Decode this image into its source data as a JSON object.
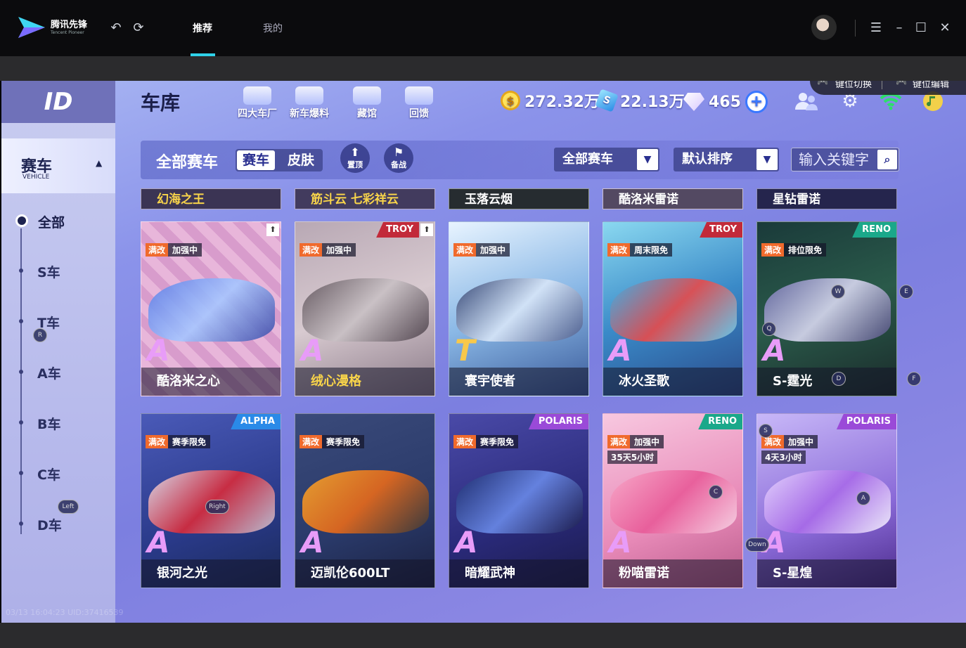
{
  "app": {
    "name": "腾讯先锋",
    "name_sub": "Tencent Pioneer"
  },
  "nav": {
    "tabs": [
      "推荐",
      "我的"
    ],
    "active": 0
  },
  "keybar": {
    "switch_label": "键位切换",
    "edit_label": "键位编辑"
  },
  "game": {
    "logo": "ID",
    "sidebar": {
      "header_title": "赛车",
      "header_sub": "VEHICLE",
      "items": [
        "全部",
        "S车",
        "T车",
        "A车",
        "B车",
        "C车",
        "D车"
      ]
    },
    "title": "车库",
    "hud_links": [
      "四大车厂",
      "新车爆料",
      "藏馆",
      "回馈"
    ],
    "currencies": {
      "coins": "272.32万",
      "cubes": "22.13万",
      "gems": "465"
    },
    "filter": {
      "title": "全部赛车",
      "seg_active": "赛车",
      "seg_inactive": "皮肤",
      "pin_label": "置顶",
      "prep_label": "备战",
      "dropdown1": "全部赛车",
      "dropdown2": "默认排序",
      "search_placeholder": "输入关键字"
    },
    "partial_row": [
      "幻海之王",
      "筋斗云 七彩祥云",
      "玉落云烟",
      "酷洛米雷诺",
      "星钻雷诺"
    ],
    "cards": [
      {
        "name": "酷洛米之心",
        "badge1": "满改",
        "badge2": "加强中",
        "brand": "",
        "grade": "A",
        "timer": ""
      },
      {
        "name": "绒心漫格",
        "badge1": "满改",
        "badge2": "加强中",
        "brand": "TROY",
        "grade": "A",
        "timer": ""
      },
      {
        "name": "寰宇使者",
        "badge1": "满改",
        "badge2": "加强中",
        "brand": "",
        "grade": "T",
        "timer": ""
      },
      {
        "name": "冰火圣歌",
        "badge1": "满改",
        "badge2": "周末限免",
        "brand": "TROY",
        "grade": "A",
        "timer": ""
      },
      {
        "name": "S-霆光",
        "badge1": "满改",
        "badge2": "排位限免",
        "brand": "RENO",
        "grade": "A",
        "timer": ""
      },
      {
        "name": "银河之光",
        "badge1": "满改",
        "badge2": "赛季限免",
        "brand": "ALPHA",
        "grade": "A",
        "timer": ""
      },
      {
        "name": "迈凯伦600LT",
        "badge1": "满改",
        "badge2": "赛季限免",
        "brand": "",
        "grade": "A",
        "timer": ""
      },
      {
        "name": "暗耀武神",
        "badge1": "满改",
        "badge2": "赛季限免",
        "brand": "POLARIS",
        "grade": "A",
        "timer": ""
      },
      {
        "name": "粉喵雷诺",
        "badge1": "满改",
        "badge2": "加强中",
        "brand": "RENO",
        "grade": "A",
        "timer": "35天5小时"
      },
      {
        "name": "S-星煌",
        "badge1": "满改",
        "badge2": "加强中",
        "brand": "POLARIS",
        "grade": "A",
        "timer": "4天3小时"
      }
    ],
    "key_hints": [
      "E",
      "F",
      "R",
      "Left",
      "Right",
      "W",
      "Q",
      "D",
      "C",
      "S",
      "A",
      "Down"
    ],
    "uid_text": "03/13 16:04:23 UID:37416539"
  },
  "colors": {
    "accent": "#2fd1e8",
    "badge_orange": "#f06a2c"
  }
}
